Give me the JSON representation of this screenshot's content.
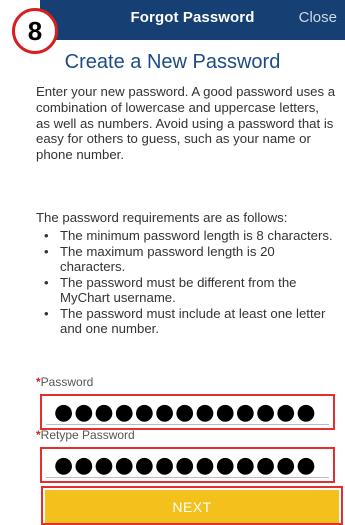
{
  "step": {
    "number": "8"
  },
  "header": {
    "title": "Forgot Password",
    "close_label": "Close"
  },
  "heading": "Create a New Password",
  "intro": "Enter your new password. A good password uses a combination of lowercase and uppercase letters, as well as numbers. Avoid using a password that is easy for others to guess, such as your name or phone number.",
  "requirements": {
    "title": "The password requirements are as follows:",
    "items": [
      "The minimum password length is 8 characters.",
      "The maximum password length is 20 characters.",
      "The password must be different from the MyChart username.",
      "The password must include at least one letter and one number."
    ]
  },
  "form": {
    "password": {
      "required_mark": "*",
      "label": "Password",
      "value": "●●●●●●●●●●●●●"
    },
    "retype": {
      "required_mark": "*",
      "label": "Retype Password",
      "value": "●●●●●●●●●●●●●"
    },
    "next_label": "NEXT"
  },
  "colors": {
    "header_bg": "#163f73",
    "heading": "#1c4c86",
    "highlight": "#e52e2e",
    "button": "#f4c01c"
  }
}
